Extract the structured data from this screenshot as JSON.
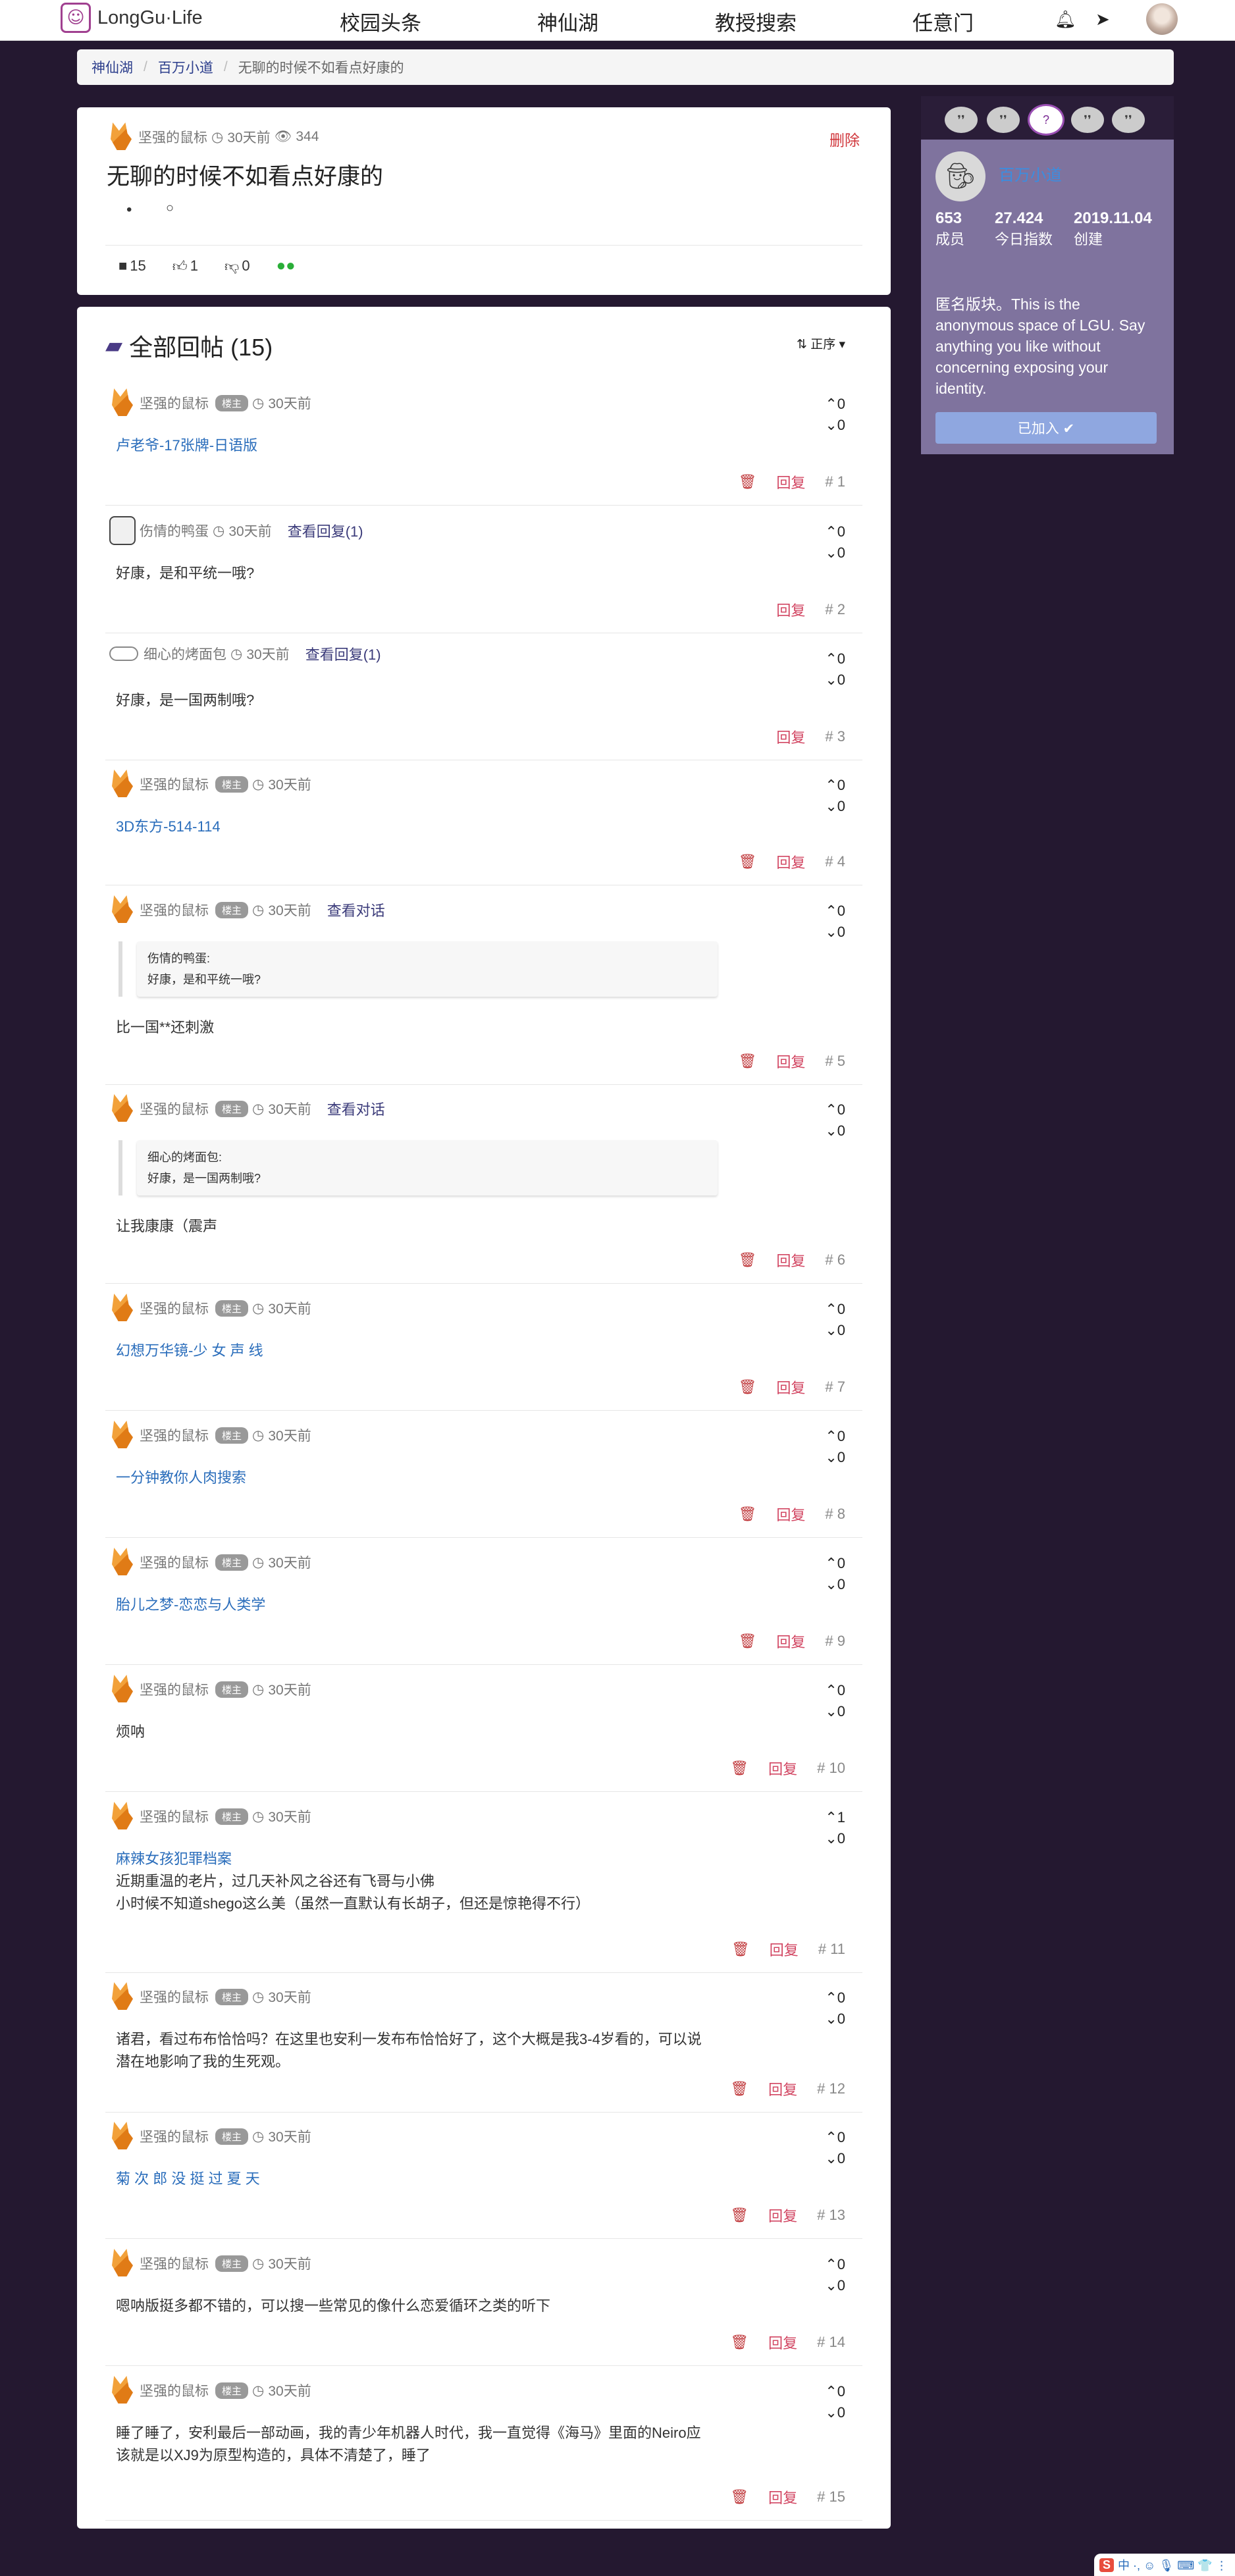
{
  "nav": {
    "logo_text": "LongGu·Life",
    "items": [
      "校园头条",
      "神仙湖",
      "教授搜索",
      "任意门"
    ]
  },
  "breadcrumb": [
    "神仙湖",
    "百万小道",
    "无聊的时候不如看点好康的"
  ],
  "post": {
    "author": "坚强的鼠标",
    "time": "30天前",
    "views": "344",
    "delete_label": "删除",
    "title": "无聊的时候不如看点好康的",
    "comments": "15",
    "likes": "1",
    "dislikes": "0"
  },
  "replies_header": {
    "title": "全部回帖 (15)",
    "sort_label": "正序"
  },
  "owner_tag": "楼主",
  "reply_label": "回复",
  "replies": [
    {
      "author": "坚强的鼠标",
      "owner": true,
      "time": "30天前",
      "up": "0",
      "down": "0",
      "lines": [
        "卢老爷-17张牌-日语版"
      ],
      "link": true,
      "num": "# 1",
      "trash": true
    },
    {
      "author": "伤情的鸭蛋",
      "owner": false,
      "time": "30天前",
      "extra": "查看回复(1)",
      "up": "0",
      "down": "0",
      "lines": [
        "好康，是和平统一哦?"
      ],
      "link": false,
      "num": "# 2",
      "trash": false
    },
    {
      "author": "细心的烤面包",
      "owner": false,
      "time": "30天前",
      "extra": "查看回复(1)",
      "up": "0",
      "down": "0",
      "lines": [
        "好康，是一国两制哦?"
      ],
      "link": false,
      "num": "# 3",
      "trash": false
    },
    {
      "author": "坚强的鼠标",
      "owner": true,
      "time": "30天前",
      "up": "0",
      "down": "0",
      "lines": [
        "3D东方-514-114"
      ],
      "link": true,
      "num": "# 4",
      "trash": true
    },
    {
      "author": "坚强的鼠标",
      "owner": true,
      "time": "30天前",
      "extra": "查看对话",
      "quote_author": "伤情的鸭蛋:",
      "quote_text": "好康，是和平统一哦?",
      "up": "0",
      "down": "0",
      "lines": [
        "比一国**还刺激"
      ],
      "link": false,
      "num": "# 5",
      "trash": true
    },
    {
      "author": "坚强的鼠标",
      "owner": true,
      "time": "30天前",
      "extra": "查看对话",
      "quote_author": "细心的烤面包:",
      "quote_text": "好康，是一国两制哦?",
      "up": "0",
      "down": "0",
      "lines": [
        "让我康康（震声"
      ],
      "link": false,
      "num": "# 6",
      "trash": true
    },
    {
      "author": "坚强的鼠标",
      "owner": true,
      "time": "30天前",
      "up": "0",
      "down": "0",
      "lines": [
        "幻想万华镜-少 女 声 线"
      ],
      "link": true,
      "num": "# 7",
      "trash": true
    },
    {
      "author": "坚强的鼠标",
      "owner": true,
      "time": "30天前",
      "up": "0",
      "down": "0",
      "lines": [
        "一分钟教你人肉搜索"
      ],
      "link": true,
      "num": "# 8",
      "trash": true
    },
    {
      "author": "坚强的鼠标",
      "owner": true,
      "time": "30天前",
      "up": "0",
      "down": "0",
      "lines": [
        "胎儿之梦-恋恋与人类学"
      ],
      "link": true,
      "num": "# 9",
      "trash": true
    },
    {
      "author": "坚强的鼠标",
      "owner": true,
      "time": "30天前",
      "up": "0",
      "down": "0",
      "lines": [
        "烦呐"
      ],
      "link": false,
      "num": "# 10",
      "trash": true
    },
    {
      "author": "坚强的鼠标",
      "owner": true,
      "time": "30天前",
      "up": "1",
      "down": "0",
      "lines": [
        "麻辣女孩犯罪档案",
        "近期重温的老片，过几天补风之谷还有飞哥与小佛",
        "小时候不知道shego这么美（虽然一直默认有长胡子，但还是惊艳得不行）"
      ],
      "link": "first",
      "num": "# 11",
      "trash": true
    },
    {
      "author": "坚强的鼠标",
      "owner": true,
      "time": "30天前",
      "up": "0",
      "down": "0",
      "lines": [
        "诸君，看过布布恰恰吗？在这里也安利一发布布恰恰好了，这个大概是我3-4岁看的，可以说",
        "潜在地影响了我的生死观。"
      ],
      "link": false,
      "num": "# 12",
      "trash": true
    },
    {
      "author": "坚强的鼠标",
      "owner": true,
      "time": "30天前",
      "up": "0",
      "down": "0",
      "lines": [
        "菊 次 郎 没 挺 过 夏 天"
      ],
      "link": true,
      "num": "# 13",
      "trash": true
    },
    {
      "author": "坚强的鼠标",
      "owner": true,
      "time": "30天前",
      "up": "0",
      "down": "0",
      "lines": [
        "嗯呐版挺多都不错的，可以搜一些常见的像什么恋爱循环之类的听下"
      ],
      "link": false,
      "num": "# 14",
      "trash": true
    },
    {
      "author": "坚强的鼠标",
      "owner": true,
      "time": "30天前",
      "up": "0",
      "down": "0",
      "lines": [
        "睡了睡了，安利最后一部动画，我的青少年机器人时代，我一直觉得《海马》里面的Neiro应",
        "该就是以XJ9为原型构造的，具体不清楚了，睡了"
      ],
      "link": false,
      "num": "# 15",
      "trash": true
    }
  ],
  "sidebar": {
    "board_name": "百万小道",
    "members_value": "653",
    "members_label": "成员",
    "index_value": "27.424",
    "index_label": "今日指数",
    "created_value": "2019.11.04",
    "created_label": "创建",
    "description": "匿名版块。This is the anonymous space of LGU. Say anything you like without concerning exposing your identity.",
    "joined_label": "已加入 ✔"
  },
  "ime": {
    "label": "中 ·, ☺ 🎙 ⌨ 👕 ⋮"
  }
}
